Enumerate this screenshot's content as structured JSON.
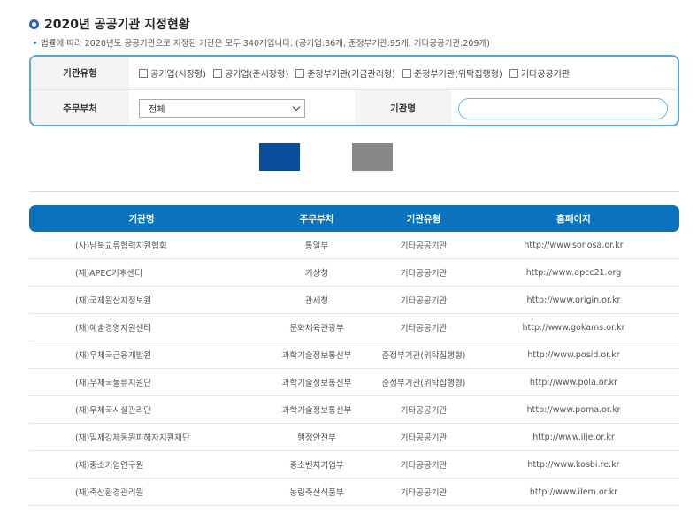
{
  "page": {
    "title": "2020년 공공기관 지정현황",
    "description": "법률에 따라 2020년도 공공기관으로 지정된 기관은 모두 340개입니다. (공기업:36개, 준정부기관:95개, 기타공공기관:209개)"
  },
  "search": {
    "type_label": "기관유형",
    "types": [
      {
        "label": "공기업(시장형)",
        "checked": false
      },
      {
        "label": "공기업(준시장형)",
        "checked": false
      },
      {
        "label": "준정부기관(기금관리형)",
        "checked": false
      },
      {
        "label": "준정부기관(위탁집행형)",
        "checked": false
      },
      {
        "label": "기타공공기관",
        "checked": false
      }
    ],
    "ministry_label": "주무부처",
    "ministry_selected": "전체",
    "name_label": "기관명",
    "name_value": ""
  },
  "table": {
    "headers": [
      "기관명",
      "주무부처",
      "기관유형",
      "홈페이지"
    ],
    "rows": [
      [
        "(사)남북교류협력지원협회",
        "통일부",
        "기타공공기관",
        "http://www.sonosa.or.kr"
      ],
      [
        "(재)APEC기후센터",
        "기상청",
        "기타공공기관",
        "http://www.apcc21.org"
      ],
      [
        "(재)국제원산지정보원",
        "관세청",
        "기타공공기관",
        "http://www.origin.or.kr"
      ],
      [
        "(재)예술경영지원센터",
        "문화체육관광부",
        "기타공공기관",
        "http://www.gokams.or.kr"
      ],
      [
        "(재)우체국금융개발원",
        "과학기술정보통신부",
        "준정부기관(위탁집행형)",
        "http://www.posid.or.kr"
      ],
      [
        "(재)우체국물류지원단",
        "과학기술정보통신부",
        "준정부기관(위탁집행형)",
        "http://www.pola.or.kr"
      ],
      [
        "(재)우체국시설관리단",
        "과학기술정보통신부",
        "기타공공기관",
        "http://www.poma.or.kr"
      ],
      [
        "(재)일제강제동원피해자지원재단",
        "행정안전부",
        "기타공공기관",
        "http://www.ilje.or.kr"
      ],
      [
        "(재)중소기업연구원",
        "중소벤처기업부",
        "기타공공기관",
        "http://www.kosbi.re.kr"
      ],
      [
        "(재)축산환경관리원",
        "농림축산식품부",
        "기타공공기관",
        "http://www.ilem.or.kr"
      ]
    ]
  },
  "colors": {
    "accent": "#0b73bd",
    "search_button": "#0b4d9a",
    "reset_button": "#878787",
    "border": "#56a7dd"
  }
}
